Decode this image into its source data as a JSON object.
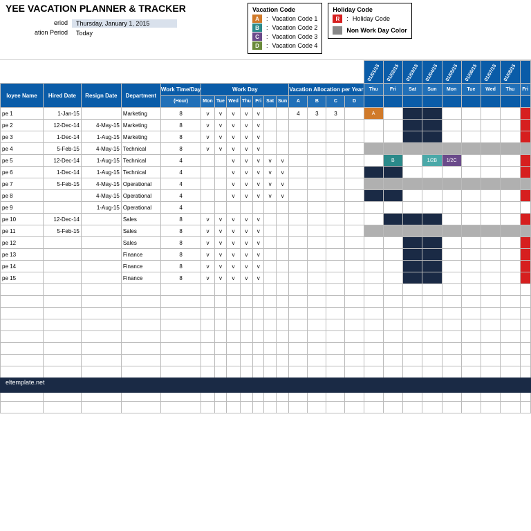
{
  "title": "YEE VACATION PLANNER & TRACKER",
  "period": {
    "label1": "eriod",
    "label2": "ation Period",
    "val1": "Thursday, January 1, 2015",
    "val2": "Today"
  },
  "vacLegend": {
    "title": "Vacation Code",
    "items": [
      {
        "code": "A",
        "color": "#d07a2a",
        "label": "Vacation Code 1"
      },
      {
        "code": "B",
        "color": "#2b8a8a",
        "label": "Vacation Code 2"
      },
      {
        "code": "C",
        "color": "#6a4a8a",
        "label": "Vacation Code 3"
      },
      {
        "code": "D",
        "color": "#6a8a3a",
        "label": "Vacation Code 4"
      }
    ]
  },
  "holLegend": {
    "title": "Holiday Code",
    "code": "R",
    "color": "#d61f1f",
    "label": "Holiday Code",
    "nonwork": "Non Work Day Color"
  },
  "headers": {
    "name": "loyee Name",
    "hired": "Hired Date",
    "resign": "Resign Date",
    "dept": "Department",
    "work": "Work Time/Day",
    "workday": "Work Day",
    "alloc": "Vacation Allocation per Year",
    "hour": "(Hour)",
    "days": [
      "Mon",
      "Tue",
      "Wed",
      "Thu",
      "Fri",
      "Sat",
      "Sun"
    ],
    "allocCols": [
      "A",
      "B",
      "C",
      "D"
    ],
    "calDays": [
      "Thu",
      "Fri",
      "Sat",
      "Sun",
      "Mon",
      "Tue",
      "Wed",
      "Thu",
      "Fri"
    ],
    "calDates": [
      "01/01/15",
      "01/02/15",
      "01/03/15",
      "01/04/15",
      "01/05/15",
      "01/06/15",
      "01/07/15",
      "01/08/15",
      ""
    ]
  },
  "rows": [
    {
      "name": "pe 1",
      "hired": "1-Jan-15",
      "resign": "",
      "dept": "Marketing",
      "work": "8",
      "days": [
        "v",
        "v",
        "v",
        "v",
        "v",
        "",
        ""
      ],
      "alloc": [
        "4",
        "3",
        "3",
        ""
      ],
      "cal": [
        "orange",
        "",
        "navy",
        "navy",
        "",
        "",
        "",
        "",
        "red"
      ]
    },
    {
      "name": "pe 2",
      "hired": "12-Dec-14",
      "resign": "4-May-15",
      "dept": "Marketing",
      "work": "8",
      "days": [
        "v",
        "v",
        "v",
        "v",
        "v",
        "",
        ""
      ],
      "alloc": [
        "",
        "",
        "",
        ""
      ],
      "cal": [
        "",
        "",
        "navy",
        "navy",
        "",
        "",
        "",
        "",
        "red"
      ]
    },
    {
      "name": "pe 3",
      "hired": "1-Dec-14",
      "resign": "1-Aug-15",
      "dept": "Marketing",
      "work": "8",
      "days": [
        "v",
        "v",
        "v",
        "v",
        "v",
        "",
        ""
      ],
      "alloc": [
        "",
        "",
        "",
        ""
      ],
      "cal": [
        "",
        "",
        "navy",
        "navy",
        "",
        "",
        "",
        "",
        "red"
      ]
    },
    {
      "name": "pe 4",
      "hired": "5-Feb-15",
      "resign": "4-May-15",
      "dept": "Technical",
      "work": "8",
      "days": [
        "v",
        "v",
        "v",
        "v",
        "v",
        "",
        ""
      ],
      "alloc": [
        "",
        "",
        "",
        ""
      ],
      "cal": [
        "gray",
        "gray",
        "gray",
        "gray",
        "gray",
        "gray",
        "gray",
        "gray",
        "gray"
      ]
    },
    {
      "name": "pe 5",
      "hired": "12-Dec-14",
      "resign": "1-Aug-15",
      "dept": "Technical",
      "work": "4",
      "days": [
        "",
        "",
        "v",
        "v",
        "v",
        "v",
        "v"
      ],
      "alloc": [
        "",
        "",
        "",
        ""
      ],
      "cal": [
        "",
        "tealB",
        "",
        "tealHalf",
        "purpleHalf",
        "",
        "",
        "",
        "red"
      ]
    },
    {
      "name": "pe 6",
      "hired": "1-Dec-14",
      "resign": "1-Aug-15",
      "dept": "Technical",
      "work": "4",
      "days": [
        "",
        "",
        "v",
        "v",
        "v",
        "v",
        "v"
      ],
      "alloc": [
        "",
        "",
        "",
        ""
      ],
      "cal": [
        "navy",
        "navy",
        "",
        "",
        "",
        "",
        "",
        "",
        "red"
      ]
    },
    {
      "name": "pe 7",
      "hired": "5-Feb-15",
      "resign": "4-May-15",
      "dept": "Operational",
      "work": "4",
      "days": [
        "",
        "",
        "v",
        "v",
        "v",
        "v",
        "v"
      ],
      "alloc": [
        "",
        "",
        "",
        ""
      ],
      "cal": [
        "gray",
        "gray",
        "gray",
        "gray",
        "gray",
        "gray",
        "gray",
        "gray",
        "gray"
      ]
    },
    {
      "name": "pe 8",
      "hired": "",
      "resign": "4-May-15",
      "dept": "Operational",
      "work": "4",
      "days": [
        "",
        "",
        "v",
        "v",
        "v",
        "v",
        "v"
      ],
      "alloc": [
        "",
        "",
        "",
        ""
      ],
      "cal": [
        "navy",
        "navy",
        "",
        "",
        "",
        "",
        "",
        "",
        "red"
      ]
    },
    {
      "name": "pe 9",
      "hired": "",
      "resign": "1-Aug-15",
      "dept": "Operational",
      "work": "4",
      "days": [
        "",
        "",
        "",
        "",
        "",
        "",
        ""
      ],
      "alloc": [
        "",
        "",
        "",
        ""
      ],
      "cal": [
        "",
        "",
        "",
        "",
        "",
        "",
        "",
        "",
        ""
      ]
    },
    {
      "name": "pe 10",
      "hired": "12-Dec-14",
      "resign": "",
      "dept": "Sales",
      "work": "8",
      "days": [
        "v",
        "v",
        "v",
        "v",
        "v",
        "",
        ""
      ],
      "alloc": [
        "",
        "",
        "",
        ""
      ],
      "cal": [
        "",
        "navy",
        "navy",
        "navy",
        "",
        "",
        "",
        "",
        "red"
      ]
    },
    {
      "name": "pe 11",
      "hired": "5-Feb-15",
      "resign": "",
      "dept": "Sales",
      "work": "8",
      "days": [
        "v",
        "v",
        "v",
        "v",
        "v",
        "",
        ""
      ],
      "alloc": [
        "",
        "",
        "",
        ""
      ],
      "cal": [
        "gray",
        "gray",
        "gray",
        "gray",
        "gray",
        "gray",
        "gray",
        "gray",
        "gray"
      ]
    },
    {
      "name": "pe 12",
      "hired": "",
      "resign": "",
      "dept": "Sales",
      "work": "8",
      "days": [
        "v",
        "v",
        "v",
        "v",
        "v",
        "",
        ""
      ],
      "alloc": [
        "",
        "",
        "",
        ""
      ],
      "cal": [
        "",
        "",
        "navy",
        "navy",
        "",
        "",
        "",
        "",
        "red"
      ]
    },
    {
      "name": "pe 13",
      "hired": "",
      "resign": "",
      "dept": "Finance",
      "work": "8",
      "days": [
        "v",
        "v",
        "v",
        "v",
        "v",
        "",
        ""
      ],
      "alloc": [
        "",
        "",
        "",
        ""
      ],
      "cal": [
        "",
        "",
        "navy",
        "navy",
        "",
        "",
        "",
        "",
        "red"
      ]
    },
    {
      "name": "pe 14",
      "hired": "",
      "resign": "",
      "dept": "Finance",
      "work": "8",
      "days": [
        "v",
        "v",
        "v",
        "v",
        "v",
        "",
        ""
      ],
      "alloc": [
        "",
        "",
        "",
        ""
      ],
      "cal": [
        "",
        "",
        "navy",
        "navy",
        "",
        "",
        "",
        "",
        "red"
      ]
    },
    {
      "name": "pe 15",
      "hired": "",
      "resign": "",
      "dept": "Finance",
      "work": "8",
      "days": [
        "v",
        "v",
        "v",
        "v",
        "v",
        "",
        ""
      ],
      "alloc": [
        "",
        "",
        "",
        ""
      ],
      "cal": [
        "",
        "",
        "navy",
        "navy",
        "",
        "",
        "",
        "",
        "red"
      ]
    }
  ],
  "emptyRows": 11,
  "footer": "eltemplate.net"
}
